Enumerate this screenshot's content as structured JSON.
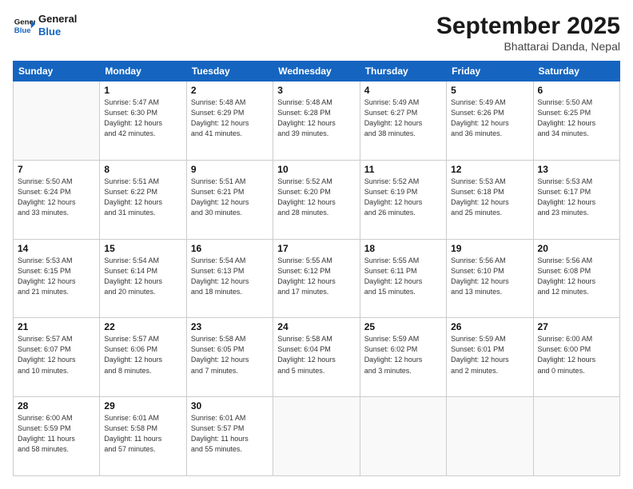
{
  "header": {
    "logo_line1": "General",
    "logo_line2": "Blue",
    "month_title": "September 2025",
    "subtitle": "Bhattarai Danda, Nepal"
  },
  "weekdays": [
    "Sunday",
    "Monday",
    "Tuesday",
    "Wednesday",
    "Thursday",
    "Friday",
    "Saturday"
  ],
  "weeks": [
    [
      {
        "day": "",
        "info": ""
      },
      {
        "day": "1",
        "info": "Sunrise: 5:47 AM\nSunset: 6:30 PM\nDaylight: 12 hours\nand 42 minutes."
      },
      {
        "day": "2",
        "info": "Sunrise: 5:48 AM\nSunset: 6:29 PM\nDaylight: 12 hours\nand 41 minutes."
      },
      {
        "day": "3",
        "info": "Sunrise: 5:48 AM\nSunset: 6:28 PM\nDaylight: 12 hours\nand 39 minutes."
      },
      {
        "day": "4",
        "info": "Sunrise: 5:49 AM\nSunset: 6:27 PM\nDaylight: 12 hours\nand 38 minutes."
      },
      {
        "day": "5",
        "info": "Sunrise: 5:49 AM\nSunset: 6:26 PM\nDaylight: 12 hours\nand 36 minutes."
      },
      {
        "day": "6",
        "info": "Sunrise: 5:50 AM\nSunset: 6:25 PM\nDaylight: 12 hours\nand 34 minutes."
      }
    ],
    [
      {
        "day": "7",
        "info": "Sunrise: 5:50 AM\nSunset: 6:24 PM\nDaylight: 12 hours\nand 33 minutes."
      },
      {
        "day": "8",
        "info": "Sunrise: 5:51 AM\nSunset: 6:22 PM\nDaylight: 12 hours\nand 31 minutes."
      },
      {
        "day": "9",
        "info": "Sunrise: 5:51 AM\nSunset: 6:21 PM\nDaylight: 12 hours\nand 30 minutes."
      },
      {
        "day": "10",
        "info": "Sunrise: 5:52 AM\nSunset: 6:20 PM\nDaylight: 12 hours\nand 28 minutes."
      },
      {
        "day": "11",
        "info": "Sunrise: 5:52 AM\nSunset: 6:19 PM\nDaylight: 12 hours\nand 26 minutes."
      },
      {
        "day": "12",
        "info": "Sunrise: 5:53 AM\nSunset: 6:18 PM\nDaylight: 12 hours\nand 25 minutes."
      },
      {
        "day": "13",
        "info": "Sunrise: 5:53 AM\nSunset: 6:17 PM\nDaylight: 12 hours\nand 23 minutes."
      }
    ],
    [
      {
        "day": "14",
        "info": "Sunrise: 5:53 AM\nSunset: 6:15 PM\nDaylight: 12 hours\nand 21 minutes."
      },
      {
        "day": "15",
        "info": "Sunrise: 5:54 AM\nSunset: 6:14 PM\nDaylight: 12 hours\nand 20 minutes."
      },
      {
        "day": "16",
        "info": "Sunrise: 5:54 AM\nSunset: 6:13 PM\nDaylight: 12 hours\nand 18 minutes."
      },
      {
        "day": "17",
        "info": "Sunrise: 5:55 AM\nSunset: 6:12 PM\nDaylight: 12 hours\nand 17 minutes."
      },
      {
        "day": "18",
        "info": "Sunrise: 5:55 AM\nSunset: 6:11 PM\nDaylight: 12 hours\nand 15 minutes."
      },
      {
        "day": "19",
        "info": "Sunrise: 5:56 AM\nSunset: 6:10 PM\nDaylight: 12 hours\nand 13 minutes."
      },
      {
        "day": "20",
        "info": "Sunrise: 5:56 AM\nSunset: 6:08 PM\nDaylight: 12 hours\nand 12 minutes."
      }
    ],
    [
      {
        "day": "21",
        "info": "Sunrise: 5:57 AM\nSunset: 6:07 PM\nDaylight: 12 hours\nand 10 minutes."
      },
      {
        "day": "22",
        "info": "Sunrise: 5:57 AM\nSunset: 6:06 PM\nDaylight: 12 hours\nand 8 minutes."
      },
      {
        "day": "23",
        "info": "Sunrise: 5:58 AM\nSunset: 6:05 PM\nDaylight: 12 hours\nand 7 minutes."
      },
      {
        "day": "24",
        "info": "Sunrise: 5:58 AM\nSunset: 6:04 PM\nDaylight: 12 hours\nand 5 minutes."
      },
      {
        "day": "25",
        "info": "Sunrise: 5:59 AM\nSunset: 6:02 PM\nDaylight: 12 hours\nand 3 minutes."
      },
      {
        "day": "26",
        "info": "Sunrise: 5:59 AM\nSunset: 6:01 PM\nDaylight: 12 hours\nand 2 minutes."
      },
      {
        "day": "27",
        "info": "Sunrise: 6:00 AM\nSunset: 6:00 PM\nDaylight: 12 hours\nand 0 minutes."
      }
    ],
    [
      {
        "day": "28",
        "info": "Sunrise: 6:00 AM\nSunset: 5:59 PM\nDaylight: 11 hours\nand 58 minutes."
      },
      {
        "day": "29",
        "info": "Sunrise: 6:01 AM\nSunset: 5:58 PM\nDaylight: 11 hours\nand 57 minutes."
      },
      {
        "day": "30",
        "info": "Sunrise: 6:01 AM\nSunset: 5:57 PM\nDaylight: 11 hours\nand 55 minutes."
      },
      {
        "day": "",
        "info": ""
      },
      {
        "day": "",
        "info": ""
      },
      {
        "day": "",
        "info": ""
      },
      {
        "day": "",
        "info": ""
      }
    ]
  ]
}
